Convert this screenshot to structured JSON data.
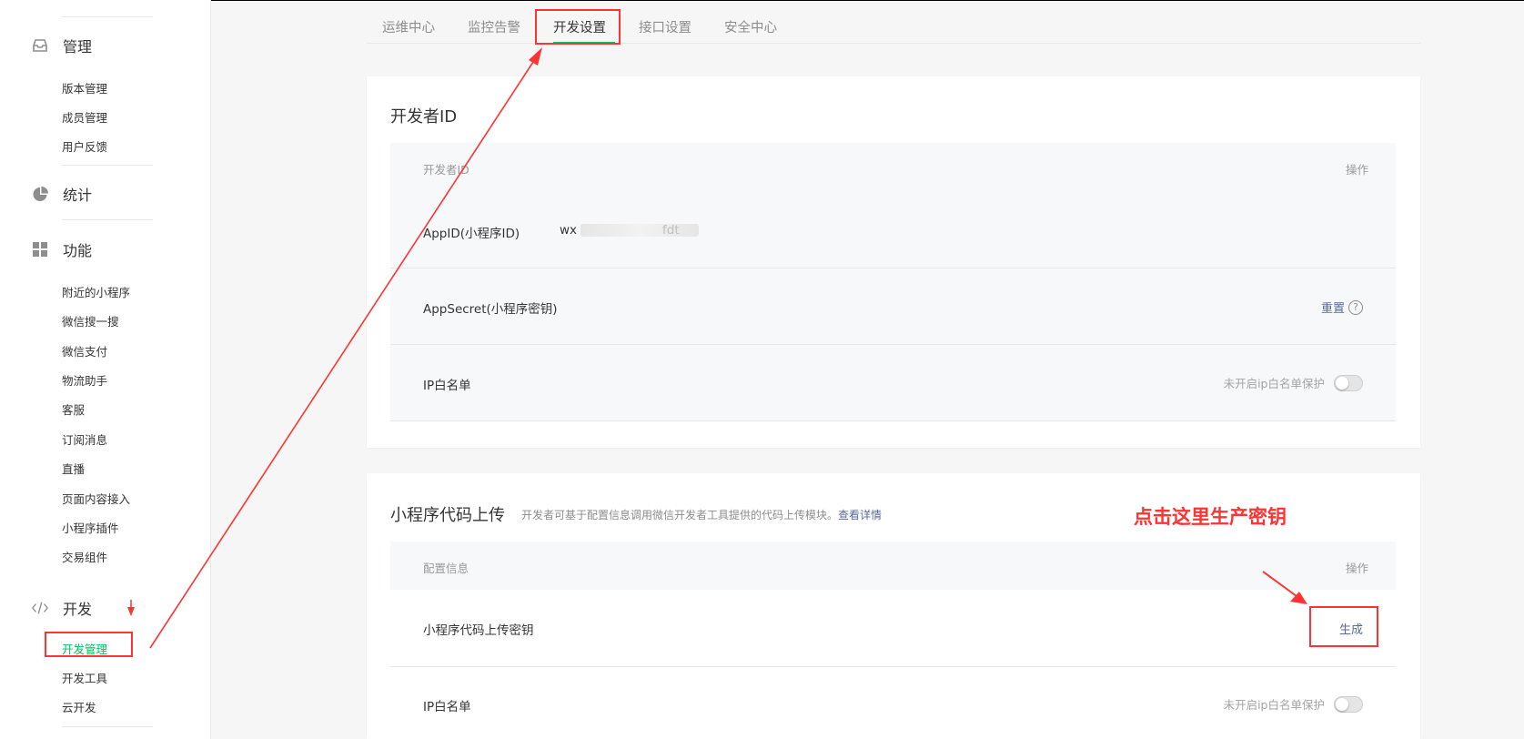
{
  "sidebar": {
    "groups": [
      {
        "icon": "inbox-icon",
        "label": "管理",
        "items": [
          "版本管理",
          "成员管理",
          "用户反馈"
        ]
      },
      {
        "icon": "pie-chart-icon",
        "label": "统计",
        "items": []
      },
      {
        "icon": "grid-icon",
        "label": "功能",
        "items": [
          "附近的小程序",
          "微信搜一搜",
          "微信支付",
          "物流助手",
          "客服",
          "订阅消息",
          "直播",
          "页面内容接入",
          "小程序插件",
          "交易组件"
        ]
      },
      {
        "icon": "code-icon",
        "label": "开发",
        "items": [
          "开发管理",
          "开发工具",
          "云开发"
        ]
      }
    ]
  },
  "tabs": [
    "运维中心",
    "监控告警",
    "开发设置",
    "接口设置",
    "安全中心"
  ],
  "developer_id": {
    "title": "开发者ID",
    "header": {
      "col1": "开发者ID",
      "col2": "操作"
    },
    "rows": {
      "appid": {
        "name": "AppID(小程序ID)",
        "value_prefix": "wx",
        "value_suffix": "fdt"
      },
      "appsecret": {
        "name": "AppSecret(小程序密钥)",
        "action": "重置",
        "help": "?"
      },
      "ip_whitelist": {
        "name": "IP白名单",
        "status": "未开启ip白名单保护"
      }
    }
  },
  "code_upload": {
    "title": "小程序代码上传",
    "subtitle": "开发者可基于配置信息调用微信开发者工具提供的代码上传模块。",
    "detail_link": "查看详情",
    "header": {
      "col1": "配置信息",
      "col2": "操作"
    },
    "rows": {
      "key": {
        "name": "小程序代码上传密钥",
        "action": "生成"
      },
      "ip_whitelist": {
        "name": "IP白名单",
        "status": "未开启ip白名单保护"
      }
    }
  },
  "annotation": {
    "text": "点击这里生产密钥",
    "color": "#ff3333"
  },
  "colors": {
    "accent": "#07c160",
    "link": "#576b95",
    "annotation": "#ff3333"
  }
}
